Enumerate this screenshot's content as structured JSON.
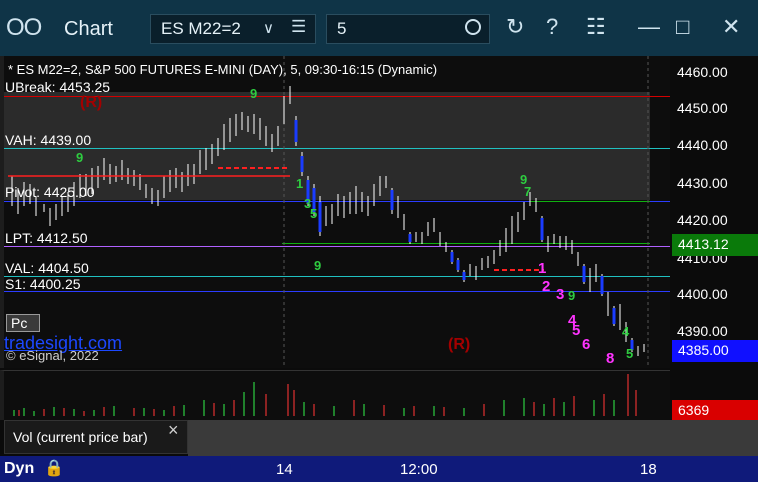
{
  "window": {
    "title": "Chart",
    "symbol": "ES M22=2",
    "interval": "5",
    "icons": [
      "chart-grid-icon",
      "chevron-down-icon",
      "menu-icon",
      "clock-icon",
      "refresh-icon",
      "help-icon",
      "template-icon",
      "minimize-icon",
      "maximize-icon",
      "close-icon"
    ]
  },
  "chart": {
    "info_line": "* ES M22=2, S&P 500 FUTURES E-MINI (DAY), 5, 09:30-16:15 (Dynamic)",
    "levels": [
      {
        "label": "UBreak: 4453.25",
        "color": "#d40000"
      },
      {
        "label": "VAH: 4439.00",
        "color": "#20c0c0"
      },
      {
        "label": "Pivot: 4425.00",
        "color": "#2b3cff"
      },
      {
        "label": "LPT: 4412.50",
        "color": "#b060ff"
      },
      {
        "label": "VAL: 4404.50",
        "color": "#20c0c0"
      },
      {
        "label": "S1: 4400.25",
        "color": "#2b3cff"
      }
    ],
    "r_marks": [
      "(R)",
      "(R)"
    ],
    "count_marks": [
      "1",
      "2",
      "3",
      "4",
      "5",
      "6",
      "8"
    ],
    "pc_button": "Pc",
    "brand": "tradesight.com",
    "copyright": "© eSignal, 2022"
  },
  "price_axis": {
    "ticks": [
      "4460.00",
      "4450.00",
      "4440.00",
      "4430.00",
      "4420.00",
      "4410.00",
      "4400.00",
      "4390.00"
    ],
    "last_level": {
      "value": "4413.12",
      "color": "#0a7a0a"
    },
    "last_price": {
      "value": "4385.00",
      "color": "#1010ff"
    }
  },
  "volume": {
    "legend": "Vol (current price bar)",
    "close_label": "×",
    "last_volume": "6369"
  },
  "statusbar": {
    "mode": "Dyn",
    "time_labels": [
      "14",
      "12:00",
      "18"
    ]
  }
}
